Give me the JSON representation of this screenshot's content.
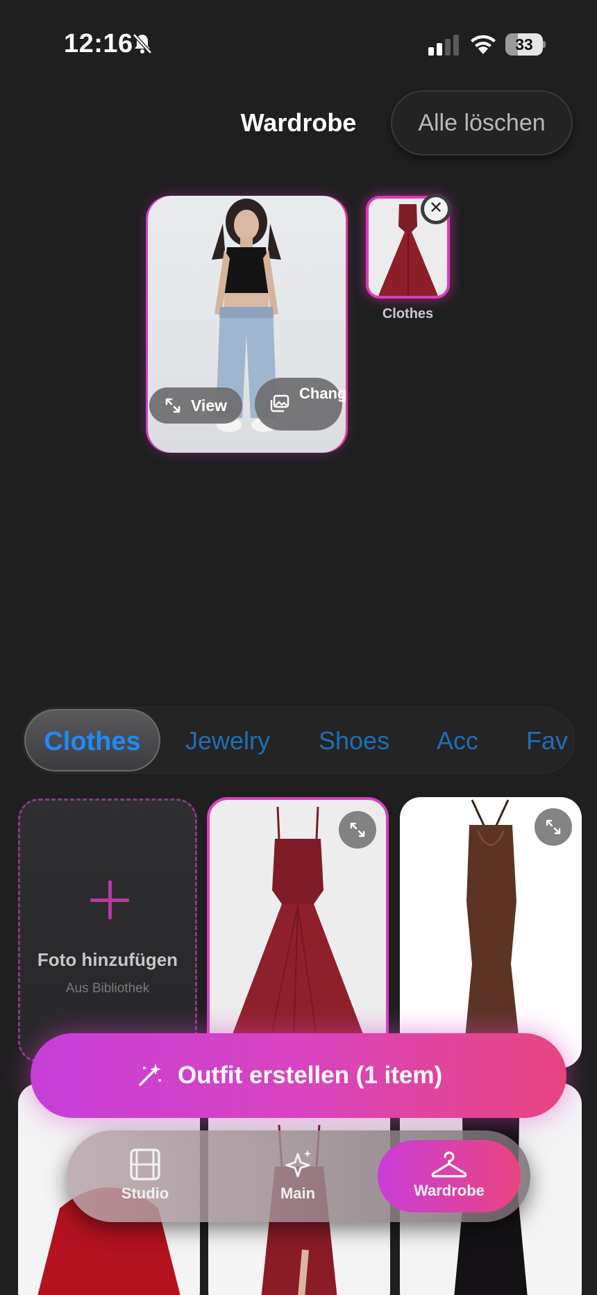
{
  "status_bar": {
    "time": "12:16",
    "battery": "33",
    "icons": [
      "bell-slash-icon",
      "cellular-signal-icon",
      "wifi-icon",
      "battery-icon"
    ]
  },
  "header": {
    "title": "Wardrobe",
    "clear_all_label": "Alle löschen"
  },
  "model_photo": {
    "view_label": "View",
    "change_label": "Change"
  },
  "selected_items": [
    {
      "label": "Clothes"
    }
  ],
  "categories": {
    "active": "Clothes",
    "tabs": [
      "Clothes",
      "Jewelry",
      "Shoes",
      "Acc",
      "Fav"
    ]
  },
  "add_photo": {
    "title": "Foto hinzufügen",
    "subtitle": "Aus Bibliothek"
  },
  "cta": {
    "label": "Outfit erstellen (1 item)"
  },
  "bottom_nav": {
    "items": [
      {
        "label": "Studio",
        "icon": "film-icon"
      },
      {
        "label": "Main",
        "icon": "sparkles-icon"
      },
      {
        "label": "Wardrobe",
        "icon": "hanger-icon"
      }
    ],
    "active": "Wardrobe"
  },
  "colors": {
    "accent_pink": "#e03ab8",
    "accent_blue": "#1d8bff",
    "background": "#1f1f20"
  }
}
